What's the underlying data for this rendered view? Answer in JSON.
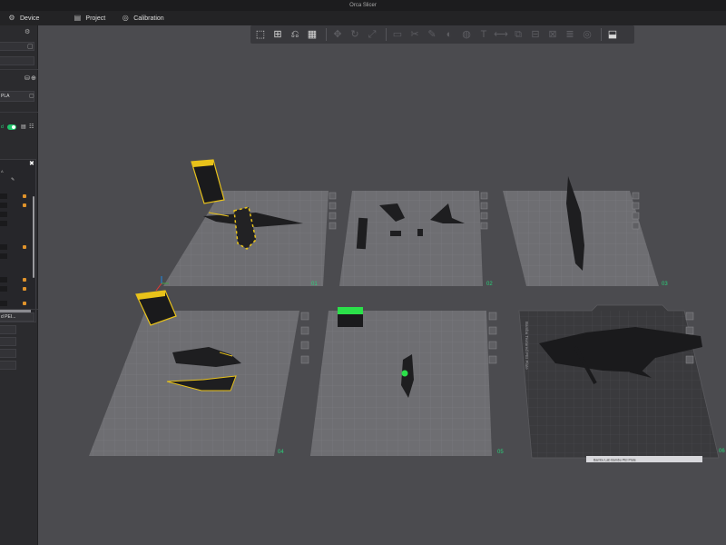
{
  "window": {
    "title": "Orca Slicer"
  },
  "menu": {
    "items": [
      {
        "label": "Device",
        "icon": "device-icon"
      },
      {
        "label": "Project",
        "icon": "project-icon"
      },
      {
        "label": "Calibration",
        "icon": "calibration-icon"
      }
    ]
  },
  "sidebar": {
    "filament_label": "PLA",
    "toggle_label": "d",
    "bottom_field": "d PEI..."
  },
  "plates": [
    {
      "number": "01"
    },
    {
      "number": "02"
    },
    {
      "number": "03"
    },
    {
      "number": "04"
    },
    {
      "number": "05"
    },
    {
      "number": "06"
    }
  ],
  "plate_06": {
    "bed_brand": "Bambu Textured PEI Plate",
    "bed_label": "Bambu Lab Bambu PEI Plate"
  },
  "colors": {
    "accent": "#1fc56b",
    "plate": "#6e6e72",
    "plate_dark": "#3a3a3d",
    "yellow": "#e8c21a"
  }
}
